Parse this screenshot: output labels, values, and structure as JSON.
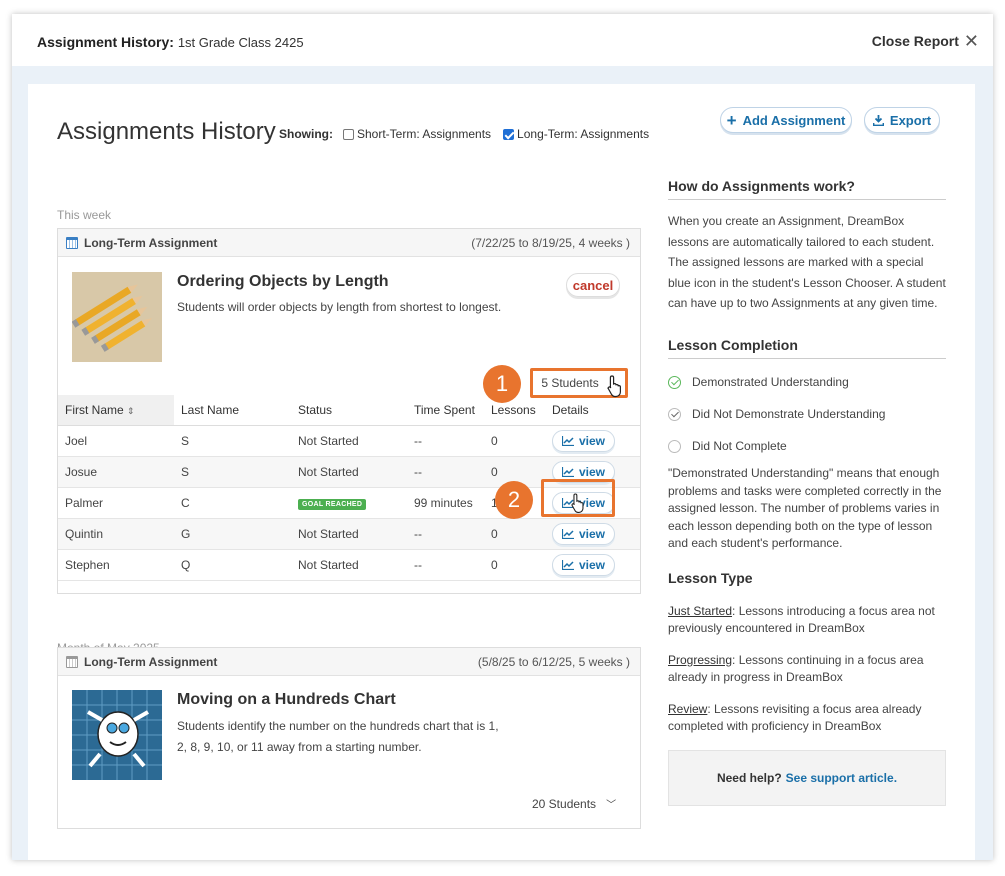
{
  "header": {
    "title_label": "Assignment History:",
    "class_name": "1st Grade Class 2425",
    "close_label": "Close Report"
  },
  "page": {
    "title": "Assignments History",
    "showing_label": "Showing:",
    "filters": [
      {
        "label": "Short-Term: Assignments",
        "checked": false
      },
      {
        "label": "Long-Term: Assignments",
        "checked": true
      }
    ],
    "add_assignment_label": "Add Assignment",
    "export_label": "Export"
  },
  "week_label": "This week",
  "assignment1": {
    "type": "Long-Term Assignment",
    "dates": "(7/22/25 to 8/19/25, 4 weeks )",
    "title": "Ordering Objects by Length",
    "description": "Students will order objects by length from shortest to longest.",
    "cancel_label": "cancel",
    "students_label": "5 Students",
    "callout1": "1",
    "callout2": "2",
    "columns": [
      "First Name",
      "Last Name",
      "Status",
      "Time Spent",
      "Lessons",
      "Details"
    ],
    "rows": [
      {
        "first": "Joel",
        "last": "S",
        "status": "Not Started",
        "time": "--",
        "lessons": "0",
        "view": "view"
      },
      {
        "first": "Josue",
        "last": "S",
        "status": "Not Started",
        "time": "--",
        "lessons": "0",
        "view": "view"
      },
      {
        "first": "Palmer",
        "last": "C",
        "status": "GOAL REACHED",
        "time": "99 minutes",
        "lessons": "1",
        "view": "view"
      },
      {
        "first": "Quintin",
        "last": "G",
        "status": "Not Started",
        "time": "--",
        "lessons": "0",
        "view": "view"
      },
      {
        "first": "Stephen",
        "last": "Q",
        "status": "Not Started",
        "time": "--",
        "lessons": "0",
        "view": "view"
      }
    ]
  },
  "month_label": "Month of May 2025",
  "assignment2": {
    "type": "Long-Term Assignment",
    "dates": "(5/8/25 to 6/12/25, 5 weeks )",
    "title": "Moving on a Hundreds Chart",
    "description": "Students identify the number on the hundreds chart that is 1, 2, 8, 9, 10, or 11 away from a starting number.",
    "students_label": "20 Students"
  },
  "sidebar": {
    "how_title": "How do Assignments work?",
    "how_text": "When you create an Assignment, DreamBox lessons are automatically tailored to each student. The assigned lessons are marked with a special blue icon in the student's Lesson Chooser. A student can have up to two Assignments at any given time.",
    "completion_title": "Lesson Completion",
    "legend": [
      "Demonstrated Understanding",
      "Did Not Demonstrate Understanding",
      "Did Not Complete"
    ],
    "completion_text": "\"Demonstrated Understanding\" means that enough problems and tasks were completed correctly in the assigned lesson. The number of problems varies in each lesson depending both on the type of lesson and each student's performance.",
    "type_title": "Lesson Type",
    "types": [
      {
        "name": "Just Started",
        "desc": ": Lessons introducing a focus area not previously encountered in DreamBox"
      },
      {
        "name": "Progressing",
        "desc": ": Lessons continuing in a focus area already in progress in DreamBox"
      },
      {
        "name": "Review",
        "desc": ": Lessons revisiting a focus area already completed with proficiency in DreamBox"
      }
    ],
    "help_label": "Need help?",
    "help_link": "See support article."
  },
  "colors": {
    "accent": "#1a6fa8",
    "callout": "#e8742e",
    "goal": "#4caf50",
    "cancel": "#c0392b"
  }
}
